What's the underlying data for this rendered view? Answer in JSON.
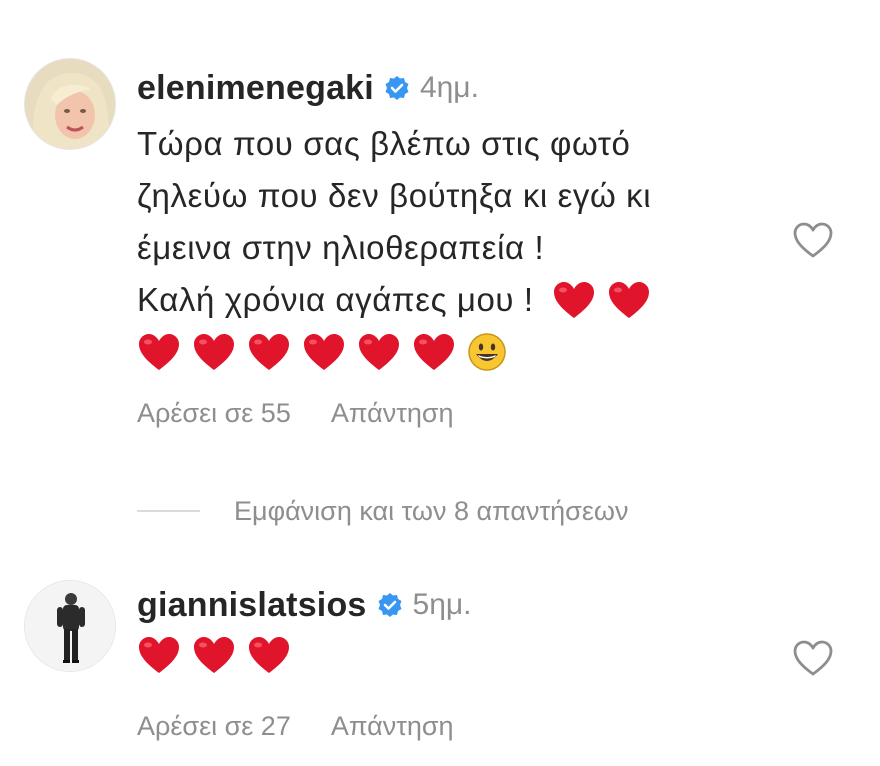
{
  "comments": [
    {
      "username": "elenimenegaki",
      "time": "4ημ.",
      "lines": [
        "Τώρα που σας βλέπω στις φωτό",
        "ζηλεύω που δεν βούτηξα κι εγώ κι",
        "έμεινα στην ηλιοθεραπεία !",
        "Καλή χρόνια αγάπες μου !"
      ],
      "emoji": [
        "red-heart",
        "red-heart",
        "red-heart",
        "red-heart",
        "red-heart",
        "red-heart",
        "red-heart",
        "red-heart",
        "grinning-face"
      ],
      "likes_label": "Αρέσει σε 55",
      "reply_label": "Απάντηση",
      "avatar_icon": "avatar-blonde-woman"
    },
    {
      "username": "giannislatsios",
      "time": "5ημ.",
      "lines": [],
      "emoji": [
        "red-heart",
        "red-heart",
        "red-heart"
      ],
      "likes_label": "Αρέσει σε 27",
      "reply_label": "Απάντηση",
      "avatar_icon": "avatar-standing-man"
    }
  ],
  "view_replies": {
    "label": "Εμφάνιση και των 8 απαντήσεων"
  },
  "colors": {
    "text": "#262626",
    "secondary": "#8e8e8e",
    "verified": "#3897f0",
    "heart": "#e0142a",
    "divider": "#dbdbdb"
  }
}
